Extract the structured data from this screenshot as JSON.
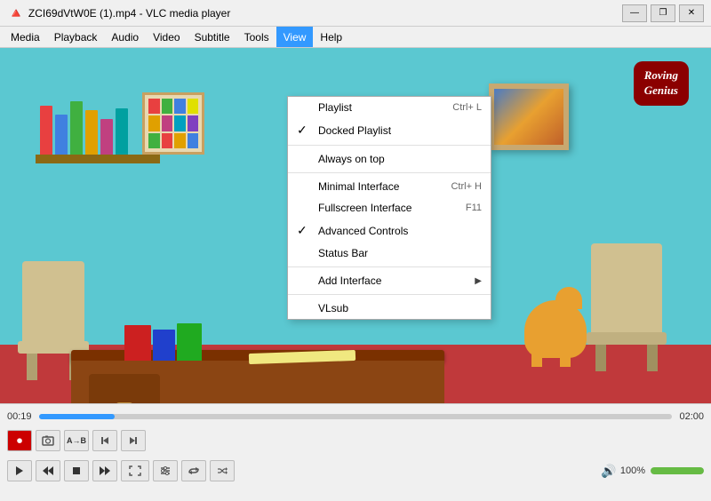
{
  "titleBar": {
    "icon": "🔺",
    "title": "ZCI69dVtW0E (1).mp4 - VLC media player"
  },
  "windowControls": {
    "minimize": "—",
    "restore": "❐",
    "close": "✕"
  },
  "menuBar": {
    "items": [
      "Media",
      "Playback",
      "Audio",
      "Video",
      "Subtitle",
      "Tools",
      "View",
      "Help"
    ]
  },
  "viewMenu": {
    "items": [
      {
        "id": "playlist",
        "label": "Playlist",
        "shortcut": "Ctrl+ L",
        "checked": false,
        "hasSub": false
      },
      {
        "id": "docked-playlist",
        "label": "Docked Playlist",
        "shortcut": "",
        "checked": true,
        "hasSub": false
      },
      {
        "id": "sep1",
        "type": "separator"
      },
      {
        "id": "always-on-top",
        "label": "Always on top",
        "shortcut": "",
        "checked": false,
        "hasSub": false
      },
      {
        "id": "sep2",
        "type": "separator"
      },
      {
        "id": "minimal-interface",
        "label": "Minimal Interface",
        "shortcut": "Ctrl+ H",
        "checked": false,
        "hasSub": false
      },
      {
        "id": "fullscreen",
        "label": "Fullscreen Interface",
        "shortcut": "F11",
        "checked": false,
        "hasSub": false
      },
      {
        "id": "advanced-controls",
        "label": "Advanced Controls",
        "shortcut": "",
        "checked": true,
        "hasSub": false
      },
      {
        "id": "status-bar",
        "label": "Status Bar",
        "shortcut": "",
        "checked": false,
        "hasSub": false
      },
      {
        "id": "sep3",
        "type": "separator"
      },
      {
        "id": "add-interface",
        "label": "Add Interface",
        "shortcut": "",
        "checked": false,
        "hasSub": true
      },
      {
        "id": "sep4",
        "type": "separator"
      },
      {
        "id": "vlsub",
        "label": "VLsub",
        "shortcut": "",
        "checked": false,
        "hasSub": false
      }
    ]
  },
  "player": {
    "timeLeft": "00:19",
    "timeRight": "02:00",
    "progressPercent": 12,
    "volumePercent": 100,
    "volumeLabel": "100%"
  },
  "logo": {
    "text": "Roving\nGenius"
  },
  "controls": {
    "row1": {
      "record": "⏺",
      "snapshot": "📷",
      "loop": "⏮",
      "frame": "⏭",
      "extra": "⏭"
    }
  }
}
